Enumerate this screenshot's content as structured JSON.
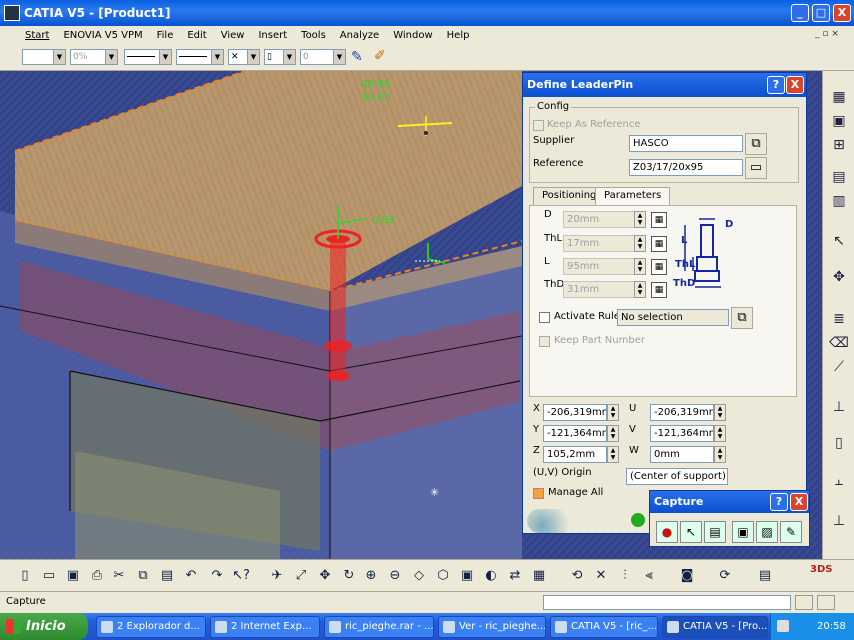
{
  "window": {
    "title": "CATIA V5 - [Product1]",
    "minimize": "_",
    "maximize": "□",
    "close": "X"
  },
  "menu": [
    "Start",
    "ENOVIA V5 VPM",
    "File",
    "Edit",
    "View",
    "Insert",
    "Tools",
    "Analyze",
    "Window",
    "Help"
  ],
  "toolbar": {
    "percent": "0%",
    "num": "0"
  },
  "viewport": {
    "label_top1": "G5.05",
    "label_top2": "99.00",
    "label_pin": "0.03"
  },
  "dialog": {
    "title": "Define LeaderPin",
    "help": "?",
    "close": "X",
    "config_label": "Config",
    "keep_as_reference": "Keep As Reference",
    "supplier_label": "Supplier",
    "supplier_value": "HASCO",
    "reference_label": "Reference",
    "reference_value": "Z03/17/20x95",
    "tabs": [
      "Positioning",
      "Parameters"
    ],
    "params": [
      {
        "label": "D",
        "value": "20mm"
      },
      {
        "label": "ThL",
        "value": "17mm"
      },
      {
        "label": "L",
        "value": "95mm"
      },
      {
        "label": "ThD",
        "value": "31mm"
      }
    ],
    "diagram_labels": {
      "d": "D",
      "l": "L",
      "thl": "ThL",
      "thd": "ThD"
    },
    "activate_rule": "Activate Rule",
    "no_selection": "No selection",
    "keep_part_number": "Keep Part Number",
    "coords": [
      {
        "label": "X",
        "value": "-206,319mm"
      },
      {
        "label": "Y",
        "value": "-121,364mm"
      },
      {
        "label": "Z",
        "value": "105,2mm"
      }
    ],
    "uv": [
      {
        "label": "U",
        "value": "-206,319mm"
      },
      {
        "label": "V",
        "value": "-121,364mm"
      },
      {
        "label": "W",
        "value": "0mm"
      }
    ],
    "uv_origin_label": "(U,V) Origin",
    "uv_origin_value": "(Center of support)",
    "manage_all": "Manage All"
  },
  "capture": {
    "title": "Capture",
    "help": "?",
    "close": "X"
  },
  "status": {
    "text": "Capture"
  },
  "taskbar": {
    "start": "Inicio",
    "tasks": [
      "2 Explorador d...",
      "2 Internet Exp...",
      "ric_pieghe.rar - ...",
      "Ver - ric_pieghe....",
      "CATIA V5 - [ric_...",
      "CATIA V5 - [Pro..."
    ],
    "clock": "20:58"
  }
}
